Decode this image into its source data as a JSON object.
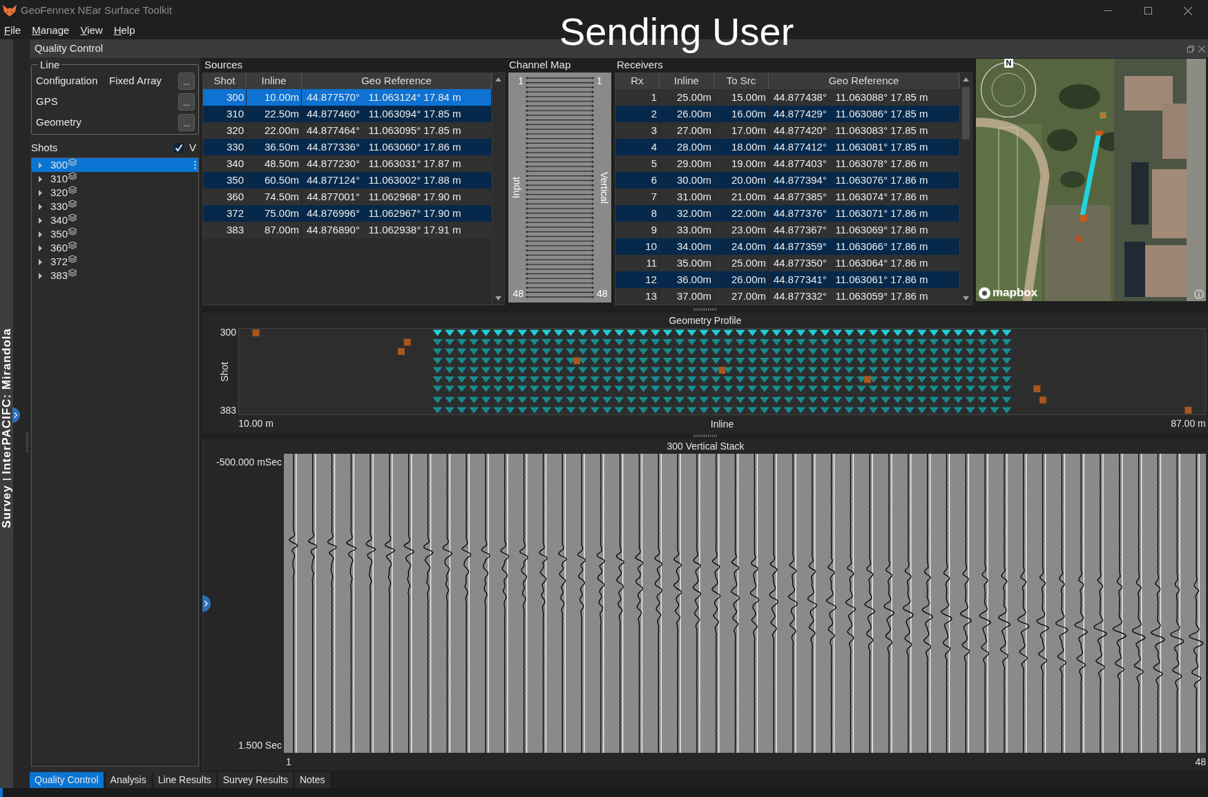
{
  "window": {
    "title": "GeoFennex NEar Surface Toolkit"
  },
  "screen_share_label": "Sending User",
  "menu": [
    "File",
    "Manage",
    "View",
    "Help"
  ],
  "side_tabs": [
    "Survey",
    "InterPACIFC: Mirandola"
  ],
  "panel": {
    "title": "Quality Control"
  },
  "line": {
    "title": "Line",
    "rows": [
      {
        "label": "Configuration",
        "value": "Fixed Array",
        "button": "..."
      },
      {
        "label": "GPS",
        "button": "..."
      },
      {
        "label": "Geometry",
        "button": "..."
      }
    ]
  },
  "shots": {
    "title": "Shots",
    "vertical_filter": {
      "label": "V",
      "checked": true
    },
    "items": [
      {
        "label": "300",
        "selected": true,
        "expanded": false
      },
      {
        "label": "310",
        "selected": false,
        "expanded": false
      },
      {
        "label": "320",
        "selected": false,
        "expanded": false
      },
      {
        "label": "330",
        "selected": false,
        "expanded": false
      },
      {
        "label": "340",
        "selected": false,
        "expanded": false
      },
      {
        "label": "350",
        "selected": false,
        "expanded": false
      },
      {
        "label": "360",
        "selected": false,
        "expanded": false
      },
      {
        "label": "372",
        "selected": false,
        "expanded": false
      },
      {
        "label": "383",
        "selected": false,
        "expanded": false
      }
    ]
  },
  "sources": {
    "title": "Sources",
    "columns": [
      "Shot",
      "Inline",
      "Geo Reference"
    ],
    "rows": [
      {
        "cells": [
          "300",
          "10.00m",
          "44.877570°   11.063124° 17.84 m"
        ],
        "selected": true
      },
      {
        "cells": [
          "310",
          "22.50m",
          "44.877460°   11.063094° 17.85 m"
        ],
        "selected": false
      },
      {
        "cells": [
          "320",
          "22.00m",
          "44.877464°   11.063095° 17.85 m"
        ],
        "selected": false
      },
      {
        "cells": [
          "330",
          "36.50m",
          "44.877336°   11.063060° 17.86 m"
        ],
        "selected": false
      },
      {
        "cells": [
          "340",
          "48.50m",
          "44.877230°   11.063031° 17.87 m"
        ],
        "selected": false
      },
      {
        "cells": [
          "350",
          "60.50m",
          "44.877124°   11.063002° 17.88 m"
        ],
        "selected": false
      },
      {
        "cells": [
          "360",
          "74.50m",
          "44.877001°   11.062968° 17.90 m"
        ],
        "selected": false
      },
      {
        "cells": [
          "372",
          "75.00m",
          "44.876996°   11.062967° 17.90 m"
        ],
        "selected": false
      },
      {
        "cells": [
          "383",
          "87.00m",
          "44.876890°   11.062938° 17.91 m"
        ],
        "selected": false
      }
    ]
  },
  "channel_map": {
    "title": "Channel Map",
    "input_label": "Input",
    "output_label": "Vertical",
    "input_first": "1",
    "input_last": "48",
    "output_first": "1",
    "output_last": "48"
  },
  "receivers": {
    "title": "Receivers",
    "columns": [
      "Rx",
      "Inline",
      "To Src",
      "Geo Reference"
    ],
    "rows": [
      {
        "cells": [
          "1",
          "25.00m",
          "15.00m",
          "44.877438°   11.063088° 17.85 m"
        ]
      },
      {
        "cells": [
          "2",
          "26.00m",
          "16.00m",
          "44.877429°   11.063086° 17.85 m"
        ]
      },
      {
        "cells": [
          "3",
          "27.00m",
          "17.00m",
          "44.877420°   11.063083° 17.85 m"
        ]
      },
      {
        "cells": [
          "4",
          "28.00m",
          "18.00m",
          "44.877412°   11.063081° 17.85 m"
        ]
      },
      {
        "cells": [
          "5",
          "29.00m",
          "19.00m",
          "44.877403°   11.063078° 17.86 m"
        ]
      },
      {
        "cells": [
          "6",
          "30.00m",
          "20.00m",
          "44.877394°   11.063076° 17.86 m"
        ]
      },
      {
        "cells": [
          "7",
          "31.00m",
          "21.00m",
          "44.877385°   11.063074° 17.86 m"
        ]
      },
      {
        "cells": [
          "8",
          "32.00m",
          "22.00m",
          "44.877376°   11.063071° 17.86 m"
        ]
      },
      {
        "cells": [
          "9",
          "33.00m",
          "23.00m",
          "44.877367°   11.063069° 17.86 m"
        ]
      },
      {
        "cells": [
          "10",
          "34.00m",
          "24.00m",
          "44.877359°   11.063066° 17.86 m"
        ]
      },
      {
        "cells": [
          "11",
          "35.00m",
          "25.00m",
          "44.877350°   11.063064° 17.86 m"
        ]
      },
      {
        "cells": [
          "12",
          "36.00m",
          "26.00m",
          "44.877341°   11.063061° 17.86 m"
        ]
      },
      {
        "cells": [
          "13",
          "37.00m",
          "27.00m",
          "44.877332°   11.063059° 17.86 m"
        ]
      }
    ]
  },
  "map": {
    "compass_label": "N",
    "attribution": "mapbox"
  },
  "geometry_profile": {
    "chart_data": {
      "type": "scatter",
      "title": "Geometry Profile",
      "xlabel": "Inline",
      "ylabel": "Shot",
      "xlim": [
        8.6,
        88.4
      ],
      "ylim": [
        387.4,
        295.6
      ],
      "xticks": [
        {
          "value": 10,
          "label": "10.00 m"
        },
        {
          "value": 87,
          "label": "87.00 m"
        }
      ],
      "yticks": [
        300,
        383
      ],
      "series": [
        {
          "color": "#a9561f",
          "x": [
            10,
            22.5,
            22,
            36.5,
            48.5,
            60.5,
            74.5,
            75,
            87
          ],
          "values": [
            300,
            310,
            320,
            330,
            340,
            350,
            360,
            372,
            383
          ]
        },
        {
          "color": "#22cdd6",
          "x": [
            25,
            26,
            27,
            28,
            29,
            30,
            31,
            32,
            33,
            34,
            35,
            36,
            37,
            38,
            39,
            40,
            41,
            42,
            43,
            44,
            45,
            46,
            47,
            48,
            49,
            50,
            51,
            52,
            53,
            54,
            55,
            56,
            57,
            58,
            59,
            60,
            61,
            62,
            63,
            64,
            65,
            66,
            67,
            68,
            69,
            70,
            71,
            72
          ],
          "values": [
            300,
            300,
            300,
            300,
            300,
            300,
            300,
            300,
            300,
            300,
            300,
            300,
            300,
            300,
            300,
            300,
            300,
            300,
            300,
            300,
            300,
            300,
            300,
            300,
            300,
            300,
            300,
            300,
            300,
            300,
            300,
            300,
            300,
            300,
            300,
            300,
            300,
            300,
            300,
            300,
            300,
            300,
            300,
            300,
            300,
            300,
            300,
            300
          ]
        },
        {
          "color": "#178c90",
          "x": [
            25,
            26,
            27,
            28,
            29,
            30,
            31,
            32,
            33,
            34,
            35,
            36,
            37,
            38,
            39,
            40,
            41,
            42,
            43,
            44,
            45,
            46,
            47,
            48,
            49,
            50,
            51,
            52,
            53,
            54,
            55,
            56,
            57,
            58,
            59,
            60,
            61,
            62,
            63,
            64,
            65,
            66,
            67,
            68,
            69,
            70,
            71,
            72
          ],
          "values": [
            310,
            310,
            310,
            310,
            310,
            310,
            310,
            310,
            310,
            310,
            310,
            310,
            310,
            310,
            310,
            310,
            310,
            310,
            310,
            310,
            310,
            310,
            310,
            310,
            310,
            310,
            310,
            310,
            310,
            310,
            310,
            310,
            310,
            310,
            310,
            310,
            310,
            310,
            310,
            310,
            310,
            310,
            310,
            310,
            310,
            310,
            310,
            310
          ]
        },
        {
          "color": "#178c90",
          "x": [
            25,
            26,
            27,
            28,
            29,
            30,
            31,
            32,
            33,
            34,
            35,
            36,
            37,
            38,
            39,
            40,
            41,
            42,
            43,
            44,
            45,
            46,
            47,
            48,
            49,
            50,
            51,
            52,
            53,
            54,
            55,
            56,
            57,
            58,
            59,
            60,
            61,
            62,
            63,
            64,
            65,
            66,
            67,
            68,
            69,
            70,
            71,
            72
          ],
          "values": [
            320,
            320,
            320,
            320,
            320,
            320,
            320,
            320,
            320,
            320,
            320,
            320,
            320,
            320,
            320,
            320,
            320,
            320,
            320,
            320,
            320,
            320,
            320,
            320,
            320,
            320,
            320,
            320,
            320,
            320,
            320,
            320,
            320,
            320,
            320,
            320,
            320,
            320,
            320,
            320,
            320,
            320,
            320,
            320,
            320,
            320,
            320,
            320
          ]
        },
        {
          "color": "#178c90",
          "x": [
            25,
            26,
            27,
            28,
            29,
            30,
            31,
            32,
            33,
            34,
            35,
            36,
            37,
            38,
            39,
            40,
            41,
            42,
            43,
            44,
            45,
            46,
            47,
            48,
            49,
            50,
            51,
            52,
            53,
            54,
            55,
            56,
            57,
            58,
            59,
            60,
            61,
            62,
            63,
            64,
            65,
            66,
            67,
            68,
            69,
            70,
            71,
            72
          ],
          "values": [
            330,
            330,
            330,
            330,
            330,
            330,
            330,
            330,
            330,
            330,
            330,
            330,
            330,
            330,
            330,
            330,
            330,
            330,
            330,
            330,
            330,
            330,
            330,
            330,
            330,
            330,
            330,
            330,
            330,
            330,
            330,
            330,
            330,
            330,
            330,
            330,
            330,
            330,
            330,
            330,
            330,
            330,
            330,
            330,
            330,
            330,
            330,
            330
          ]
        },
        {
          "color": "#178c90",
          "x": [
            25,
            26,
            27,
            28,
            29,
            30,
            31,
            32,
            33,
            34,
            35,
            36,
            37,
            38,
            39,
            40,
            41,
            42,
            43,
            44,
            45,
            46,
            47,
            48,
            49,
            50,
            51,
            52,
            53,
            54,
            55,
            56,
            57,
            58,
            59,
            60,
            61,
            62,
            63,
            64,
            65,
            66,
            67,
            68,
            69,
            70,
            71,
            72
          ],
          "values": [
            340,
            340,
            340,
            340,
            340,
            340,
            340,
            340,
            340,
            340,
            340,
            340,
            340,
            340,
            340,
            340,
            340,
            340,
            340,
            340,
            340,
            340,
            340,
            340,
            340,
            340,
            340,
            340,
            340,
            340,
            340,
            340,
            340,
            340,
            340,
            340,
            340,
            340,
            340,
            340,
            340,
            340,
            340,
            340,
            340,
            340,
            340,
            340
          ]
        },
        {
          "color": "#178c90",
          "x": [
            25,
            26,
            27,
            28,
            29,
            30,
            31,
            32,
            33,
            34,
            35,
            36,
            37,
            38,
            39,
            40,
            41,
            42,
            43,
            44,
            45,
            46,
            47,
            48,
            49,
            50,
            51,
            52,
            53,
            54,
            55,
            56,
            57,
            58,
            59,
            60,
            61,
            62,
            63,
            64,
            65,
            66,
            67,
            68,
            69,
            70,
            71,
            72
          ],
          "values": [
            350,
            350,
            350,
            350,
            350,
            350,
            350,
            350,
            350,
            350,
            350,
            350,
            350,
            350,
            350,
            350,
            350,
            350,
            350,
            350,
            350,
            350,
            350,
            350,
            350,
            350,
            350,
            350,
            350,
            350,
            350,
            350,
            350,
            350,
            350,
            350,
            350,
            350,
            350,
            350,
            350,
            350,
            350,
            350,
            350,
            350,
            350,
            350
          ]
        },
        {
          "color": "#178c90",
          "x": [
            25,
            26,
            27,
            28,
            29,
            30,
            31,
            32,
            33,
            34,
            35,
            36,
            37,
            38,
            39,
            40,
            41,
            42,
            43,
            44,
            45,
            46,
            47,
            48,
            49,
            50,
            51,
            52,
            53,
            54,
            55,
            56,
            57,
            58,
            59,
            60,
            61,
            62,
            63,
            64,
            65,
            66,
            67,
            68,
            69,
            70,
            71,
            72
          ],
          "values": [
            360,
            360,
            360,
            360,
            360,
            360,
            360,
            360,
            360,
            360,
            360,
            360,
            360,
            360,
            360,
            360,
            360,
            360,
            360,
            360,
            360,
            360,
            360,
            360,
            360,
            360,
            360,
            360,
            360,
            360,
            360,
            360,
            360,
            360,
            360,
            360,
            360,
            360,
            360,
            360,
            360,
            360,
            360,
            360,
            360,
            360,
            360,
            360
          ]
        },
        {
          "color": "#178c90",
          "x": [
            25,
            26,
            27,
            28,
            29,
            30,
            31,
            32,
            33,
            34,
            35,
            36,
            37,
            38,
            39,
            40,
            41,
            42,
            43,
            44,
            45,
            46,
            47,
            48,
            49,
            50,
            51,
            52,
            53,
            54,
            55,
            56,
            57,
            58,
            59,
            60,
            61,
            62,
            63,
            64,
            65,
            66,
            67,
            68,
            69,
            70,
            71,
            72
          ],
          "values": [
            372,
            372,
            372,
            372,
            372,
            372,
            372,
            372,
            372,
            372,
            372,
            372,
            372,
            372,
            372,
            372,
            372,
            372,
            372,
            372,
            372,
            372,
            372,
            372,
            372,
            372,
            372,
            372,
            372,
            372,
            372,
            372,
            372,
            372,
            372,
            372,
            372,
            372,
            372,
            372,
            372,
            372,
            372,
            372,
            372,
            372,
            372,
            372
          ]
        },
        {
          "color": "#178c90",
          "x": [
            25,
            26,
            27,
            28,
            29,
            30,
            31,
            32,
            33,
            34,
            35,
            36,
            37,
            38,
            39,
            40,
            41,
            42,
            43,
            44,
            45,
            46,
            47,
            48,
            49,
            50,
            51,
            52,
            53,
            54,
            55,
            56,
            57,
            58,
            59,
            60,
            61,
            62,
            63,
            64,
            65,
            66,
            67,
            68,
            69,
            70,
            71,
            72
          ],
          "values": [
            383,
            383,
            383,
            383,
            383,
            383,
            383,
            383,
            383,
            383,
            383,
            383,
            383,
            383,
            383,
            383,
            383,
            383,
            383,
            383,
            383,
            383,
            383,
            383,
            383,
            383,
            383,
            383,
            383,
            383,
            383,
            383,
            383,
            383,
            383,
            383,
            383,
            383,
            383,
            383,
            383,
            383,
            383,
            383,
            383,
            383,
            383,
            383
          ]
        }
      ]
    }
  },
  "vertical_stack": {
    "title": "300 Vertical Stack",
    "time_top": "-500.000 mSec",
    "time_bottom": "1.500 Sec",
    "trace_first": "1",
    "trace_last": "48"
  },
  "bottom_tabs": [
    {
      "label": "Quality Control",
      "selected": true
    },
    {
      "label": "Analysis",
      "selected": false
    },
    {
      "label": "Line Results",
      "selected": false
    },
    {
      "label": "Survey Results",
      "selected": false
    },
    {
      "label": "Notes",
      "selected": false
    }
  ]
}
